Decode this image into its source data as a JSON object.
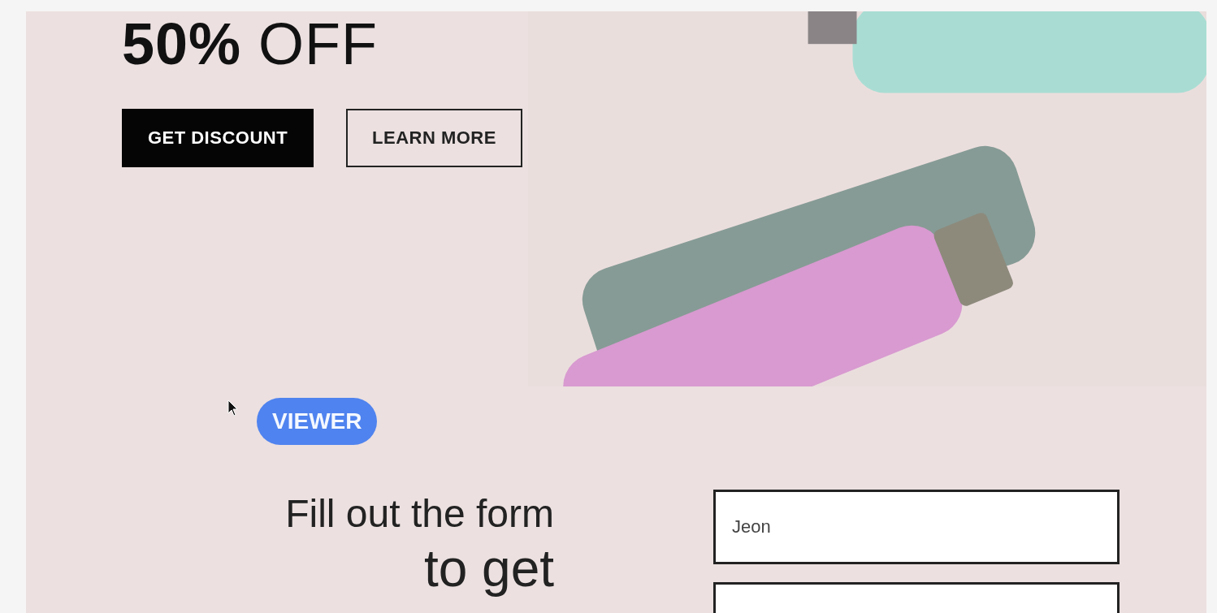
{
  "hero": {
    "headline": "**50%** OFF",
    "buttons": [
      {
        "label": "GET DISCOUNT",
        "kind": "filled"
      },
      {
        "label": "LEARN MORE",
        "kind": "outline"
      }
    ]
  },
  "badge": {
    "label": "VIEWER"
  },
  "form": {
    "heading_lines": [
      "Fill out the form",
      "to get"
    ],
    "fields": [
      {
        "kind": "filled",
        "value": "Jeon"
      },
      {
        "kind": "empty"
      }
    ]
  }
}
